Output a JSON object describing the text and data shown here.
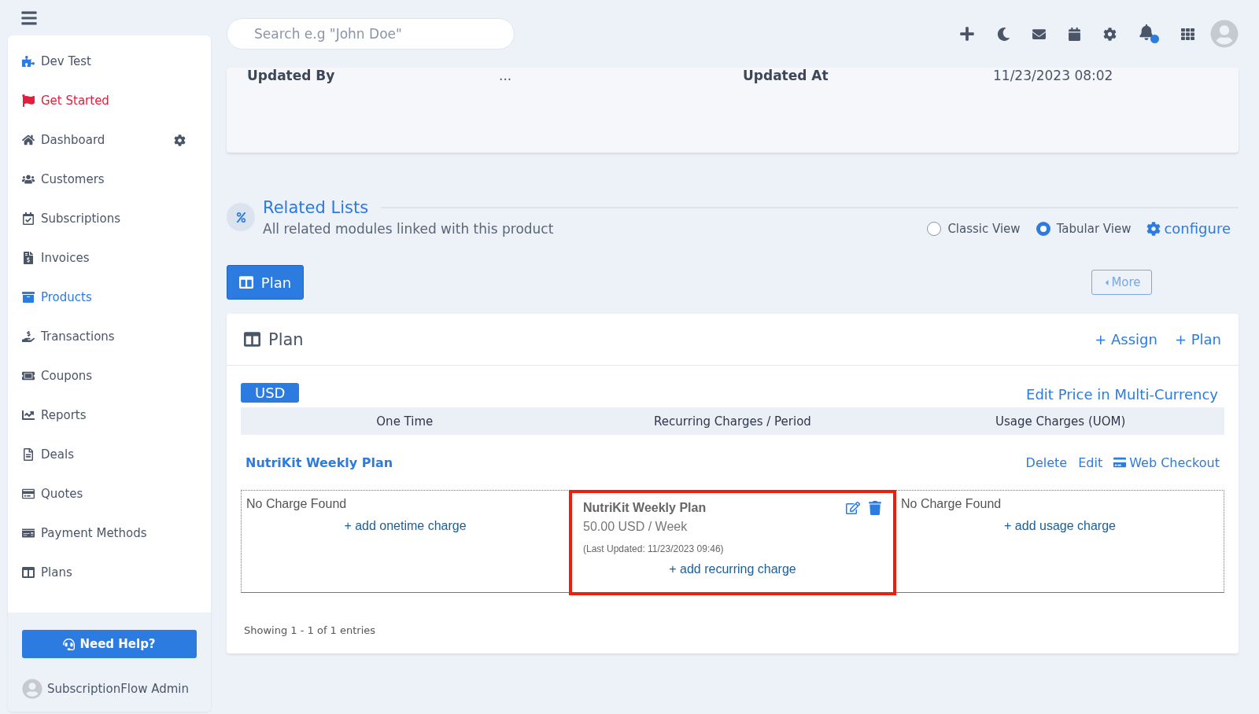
{
  "search": {
    "placeholder": "Search e.g \"John Doe\""
  },
  "sidebar": {
    "items": [
      {
        "label": "Dev Test",
        "kind": "brand",
        "selected": false
      },
      {
        "label": "Get Started",
        "kind": "promo",
        "selected": false
      },
      {
        "label": "Dashboard",
        "kind": "settings",
        "selected": false
      },
      {
        "label": "Customers",
        "kind": "link",
        "selected": false
      },
      {
        "label": "Subscriptions",
        "kind": "link",
        "selected": false
      },
      {
        "label": "Invoices",
        "kind": "link",
        "selected": false
      },
      {
        "label": "Products",
        "kind": "link",
        "selected": true
      },
      {
        "label": "Transactions",
        "kind": "link",
        "selected": false
      },
      {
        "label": "Coupons",
        "kind": "link",
        "selected": false
      },
      {
        "label": "Reports",
        "kind": "link",
        "selected": false
      },
      {
        "label": "Deals",
        "kind": "link",
        "selected": false
      },
      {
        "label": "Quotes",
        "kind": "link",
        "selected": false
      },
      {
        "label": "Payment Methods",
        "kind": "link",
        "selected": false
      },
      {
        "label": "Plans",
        "kind": "link",
        "selected": false
      }
    ],
    "help_button": "Need Help?",
    "user": "SubscriptionFlow Admin"
  },
  "info_card": {
    "fields": [
      {
        "label": "Updated By",
        "value": "..."
      },
      {
        "label": "Updated At",
        "value": "11/23/2023 08:02"
      }
    ]
  },
  "related": {
    "title": "Related Lists",
    "subtitle": "All related modules linked with this product",
    "views": [
      {
        "label": "Classic View",
        "selected": false
      },
      {
        "label": "Tabular View",
        "selected": true
      }
    ],
    "configure": "configure",
    "tab_button": "Plan",
    "more_button": "More"
  },
  "plan_card": {
    "title": "Plan",
    "actions": [
      "+ Assign",
      "+ Plan"
    ],
    "currency": "USD",
    "multi_currency_link": "Edit Price in Multi-Currency",
    "columns": [
      "One Time",
      "Recurring Charges / Period",
      "Usage Charges (UOM)"
    ],
    "plan_name": "NutriKit Weekly Plan",
    "row_actions": [
      "Delete",
      "Edit",
      "Web Checkout"
    ],
    "cells": [
      {
        "kind": "empty",
        "text": "No Charge Found",
        "add_link": "+ add onetime charge",
        "highlighted": false
      },
      {
        "kind": "charge",
        "title": "NutriKit Weekly Plan",
        "price": "50.00 USD / Week",
        "updated": "(Last Updated: 11/23/2023 09:46)",
        "add_link": "+ add recurring charge",
        "highlighted": true
      },
      {
        "kind": "empty",
        "text": "No Charge Found",
        "add_link": "+ add usage charge",
        "highlighted": false
      }
    ],
    "footer": "Showing 1 - 1 of 1 entries"
  }
}
